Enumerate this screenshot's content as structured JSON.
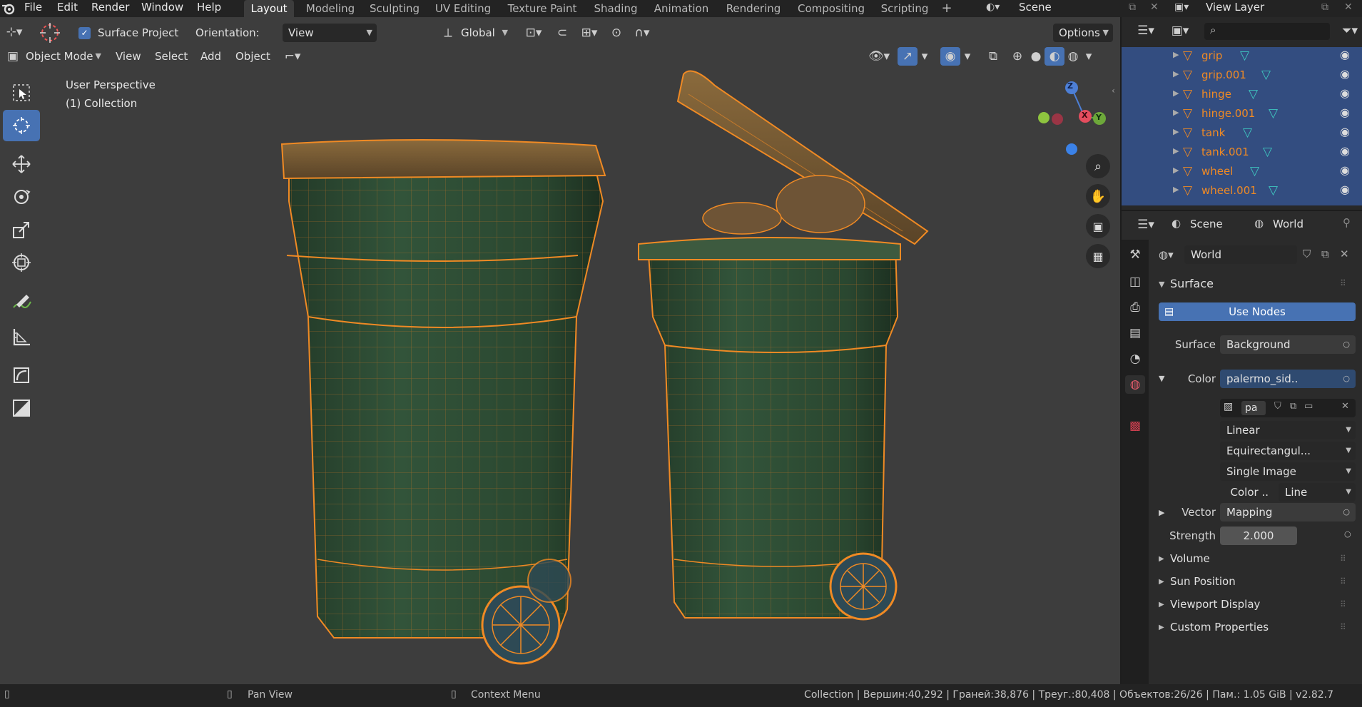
{
  "menu": [
    "File",
    "Edit",
    "Render",
    "Window",
    "Help"
  ],
  "workspaces": [
    "Layout",
    "Modeling",
    "Sculpting",
    "UV Editing",
    "Texture Paint",
    "Shading",
    "Animation",
    "Rendering",
    "Compositing",
    "Scripting"
  ],
  "active_workspace": "Layout",
  "scene_name": "Scene",
  "view_layer_name": "View Layer",
  "tool_header": {
    "surface_project_label": "Surface Project",
    "orientation_label": "Orientation:",
    "orientation_value": "View",
    "transform_orientation": "Global",
    "options_label": "Options"
  },
  "viewport_header": {
    "mode": "Object Mode",
    "view": "View",
    "select": "Select",
    "add": "Add",
    "object": "Object"
  },
  "viewport_overlay": {
    "perspective": "User Perspective",
    "collection": "(1) Collection"
  },
  "gizmo_axes": {
    "z": "Z",
    "x": "X",
    "y": "Y"
  },
  "outliner_items": [
    "grip",
    "grip.001",
    "hinge",
    "hinge.001",
    "tank",
    "tank.001",
    "wheel",
    "wheel.001"
  ],
  "properties": {
    "breadcrumb_scene": "Scene",
    "breadcrumb_world": "World",
    "world_name": "World",
    "surface_panel": "Surface",
    "use_nodes_label": "Use Nodes",
    "surface_label": "Surface",
    "surface_value": "Background",
    "color_label": "Color",
    "color_value": "palermo_sid..",
    "image_name": "pa",
    "interpolation": "Linear",
    "projection": "Equirectangul...",
    "source": "Single Image",
    "color_space_label": "Color ..",
    "color_space_value": "Line",
    "vector_label": "Vector",
    "vector_value": "Mapping",
    "strength_label": "Strength",
    "strength_value": "2.000",
    "panels": [
      "Volume",
      "Sun Position",
      "Viewport Display",
      "Custom Properties"
    ]
  },
  "statusbar": {
    "pan_view": "Pan View",
    "context_menu": "Context Menu",
    "stats": "Collection | Вершин:40,292 | Граней:38,876 | Треуг.:80,408 | Объектов:26/26 | Пам.: 1.05 GiB | v2.82.7"
  },
  "colors": {
    "accent_blue": "#4772b3",
    "selection_orange": "#f08a24",
    "outliner_selected_bg": "#334d80",
    "viewport_bg": "#3d3d3d"
  }
}
